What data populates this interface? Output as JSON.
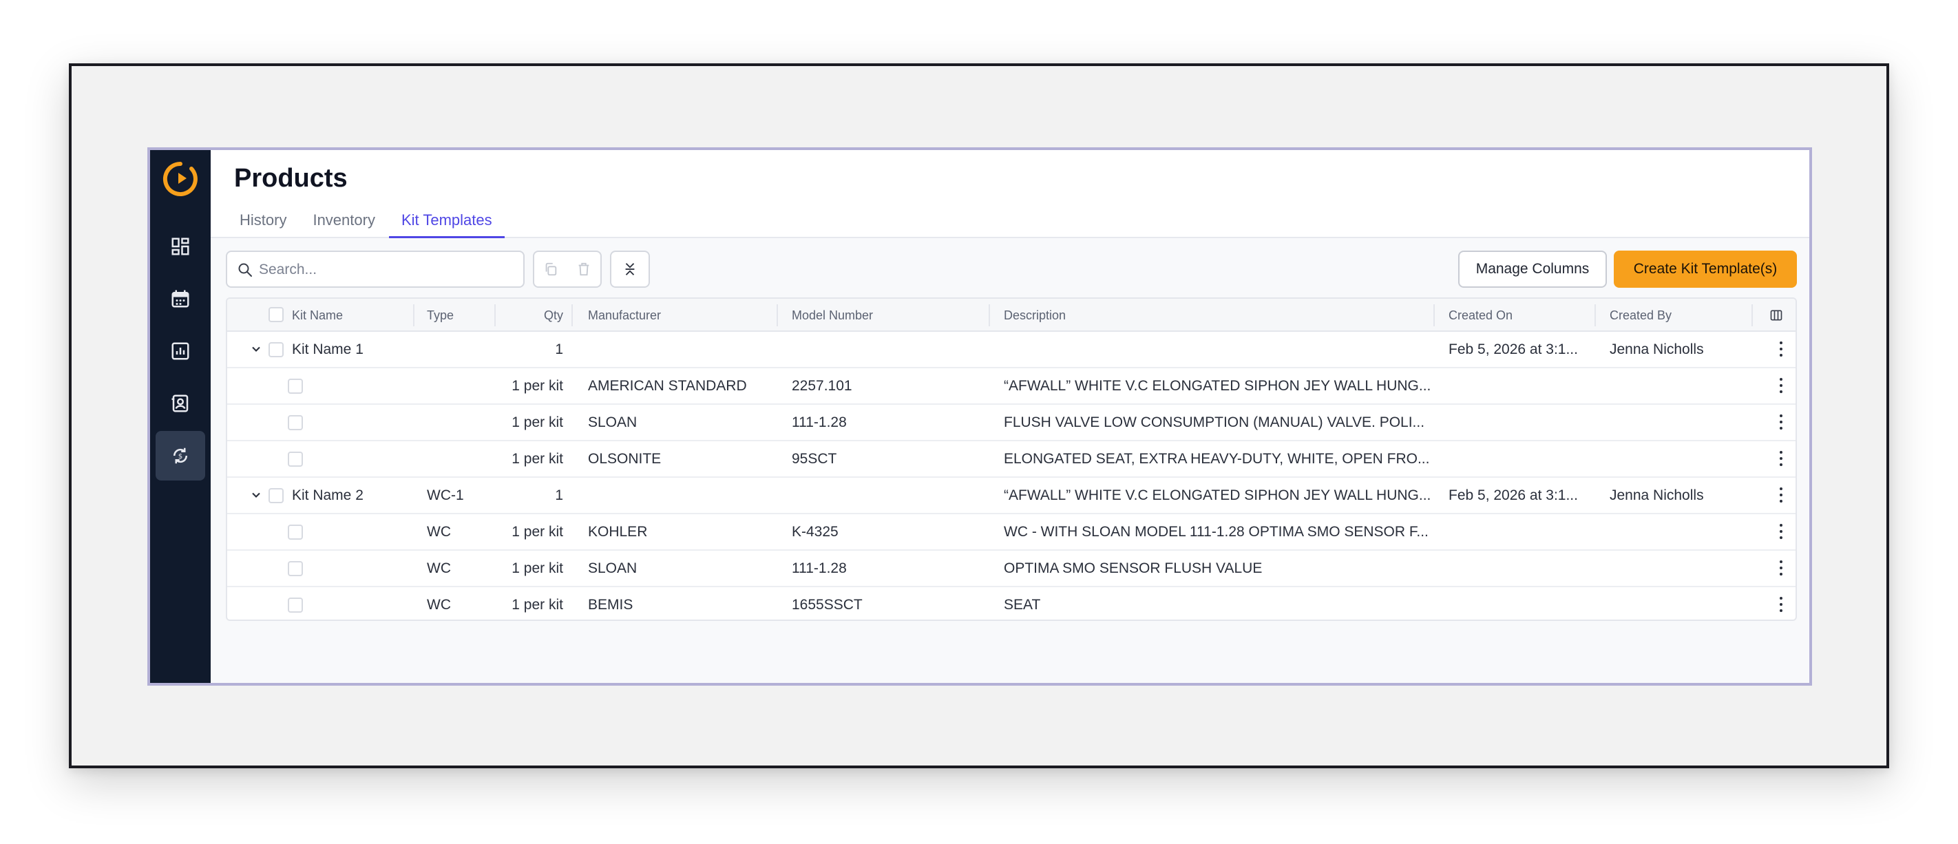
{
  "header": {
    "title": "Products"
  },
  "tabs": [
    {
      "label": "History"
    },
    {
      "label": "Inventory"
    },
    {
      "label": "Kit Templates",
      "active": true
    }
  ],
  "toolbar": {
    "search_placeholder": "Search...",
    "manage_columns_label": "Manage Columns",
    "create_label": "Create Kit Template(s)"
  },
  "colors": {
    "accent": "#4f46e5",
    "primary_button": "#f7a01c",
    "sidebar": "#101a2c",
    "logo": "#f7a01c"
  },
  "sidebar": {
    "items": [
      {
        "icon": "dashboard-icon"
      },
      {
        "icon": "calendar-icon"
      },
      {
        "icon": "report-chart-icon"
      },
      {
        "icon": "contact-card-icon"
      },
      {
        "icon": "sync-products-icon",
        "active": true
      }
    ]
  },
  "table": {
    "columns": [
      "Kit Name",
      "Type",
      "Qty",
      "Manufacturer",
      "Model Number",
      "Description",
      "Created On",
      "Created By"
    ],
    "rows": [
      {
        "kit": "Kit Name 1",
        "type": "",
        "qty": "1",
        "manufacturer": "",
        "model": "",
        "description": "",
        "created_on": "Feb 5, 2026 at 3:1...",
        "created_by": "Jenna Nicholls"
      },
      {
        "kit": "",
        "type": "",
        "qty": "1 per kit",
        "manufacturer": "AMERICAN STANDARD",
        "model": "2257.101",
        "description": "“AFWALL” WHITE V.C ELONGATED SIPHON JEY WALL HUNG...",
        "created_on": "",
        "created_by": ""
      },
      {
        "kit": "",
        "type": "",
        "qty": "1 per kit",
        "manufacturer": "SLOAN",
        "model": "111-1.28",
        "description": "FLUSH VALVE LOW CONSUMPTION (MANUAL) VALVE. POLI...",
        "created_on": "",
        "created_by": ""
      },
      {
        "kit": "",
        "type": "",
        "qty": "1 per kit",
        "manufacturer": "OLSONITE",
        "model": "95SCT",
        "description": "ELONGATED SEAT, EXTRA HEAVY-DUTY, WHITE, OPEN FRO...",
        "created_on": "",
        "created_by": ""
      },
      {
        "kit": "Kit Name 2",
        "type": "WC-1",
        "qty": "1",
        "manufacturer": "",
        "model": "",
        "description": "“AFWALL” WHITE V.C ELONGATED SIPHON JEY WALL HUNG...",
        "created_on": "Feb 5, 2026 at 3:1...",
        "created_by": "Jenna Nicholls"
      },
      {
        "kit": "",
        "type": "WC",
        "qty": "1 per kit",
        "manufacturer": "KOHLER",
        "model": "K-4325",
        "description": "WC - WITH SLOAN MODEL 111-1.28 OPTIMA SMO SENSOR F...",
        "created_on": "",
        "created_by": ""
      },
      {
        "kit": "",
        "type": "WC",
        "qty": "1 per kit",
        "manufacturer": "SLOAN",
        "model": "111-1.28",
        "description": "OPTIMA SMO SENSOR FLUSH VALUE",
        "created_on": "",
        "created_by": ""
      },
      {
        "kit": "",
        "type": "WC",
        "qty": "1 per kit",
        "manufacturer": "BEMIS",
        "model": "1655SSCT",
        "description": "SEAT",
        "created_on": "",
        "created_by": ""
      }
    ]
  }
}
